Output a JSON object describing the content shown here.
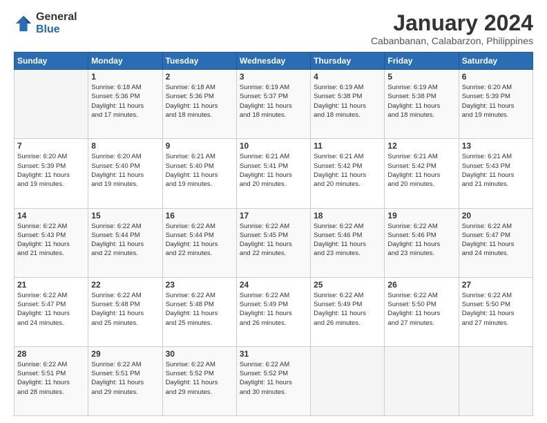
{
  "logo": {
    "general": "General",
    "blue": "Blue"
  },
  "header": {
    "title": "January 2024",
    "subtitle": "Cabanbanan, Calabarzon, Philippines"
  },
  "weekdays": [
    "Sunday",
    "Monday",
    "Tuesday",
    "Wednesday",
    "Thursday",
    "Friday",
    "Saturday"
  ],
  "weeks": [
    [
      {
        "day": "",
        "info": ""
      },
      {
        "day": "1",
        "info": "Sunrise: 6:18 AM\nSunset: 5:36 PM\nDaylight: 11 hours\nand 17 minutes."
      },
      {
        "day": "2",
        "info": "Sunrise: 6:18 AM\nSunset: 5:36 PM\nDaylight: 11 hours\nand 18 minutes."
      },
      {
        "day": "3",
        "info": "Sunrise: 6:19 AM\nSunset: 5:37 PM\nDaylight: 11 hours\nand 18 minutes."
      },
      {
        "day": "4",
        "info": "Sunrise: 6:19 AM\nSunset: 5:38 PM\nDaylight: 11 hours\nand 18 minutes."
      },
      {
        "day": "5",
        "info": "Sunrise: 6:19 AM\nSunset: 5:38 PM\nDaylight: 11 hours\nand 18 minutes."
      },
      {
        "day": "6",
        "info": "Sunrise: 6:20 AM\nSunset: 5:39 PM\nDaylight: 11 hours\nand 19 minutes."
      }
    ],
    [
      {
        "day": "7",
        "info": "Sunrise: 6:20 AM\nSunset: 5:39 PM\nDaylight: 11 hours\nand 19 minutes."
      },
      {
        "day": "8",
        "info": "Sunrise: 6:20 AM\nSunset: 5:40 PM\nDaylight: 11 hours\nand 19 minutes."
      },
      {
        "day": "9",
        "info": "Sunrise: 6:21 AM\nSunset: 5:40 PM\nDaylight: 11 hours\nand 19 minutes."
      },
      {
        "day": "10",
        "info": "Sunrise: 6:21 AM\nSunset: 5:41 PM\nDaylight: 11 hours\nand 20 minutes."
      },
      {
        "day": "11",
        "info": "Sunrise: 6:21 AM\nSunset: 5:42 PM\nDaylight: 11 hours\nand 20 minutes."
      },
      {
        "day": "12",
        "info": "Sunrise: 6:21 AM\nSunset: 5:42 PM\nDaylight: 11 hours\nand 20 minutes."
      },
      {
        "day": "13",
        "info": "Sunrise: 6:21 AM\nSunset: 5:43 PM\nDaylight: 11 hours\nand 21 minutes."
      }
    ],
    [
      {
        "day": "14",
        "info": "Sunrise: 6:22 AM\nSunset: 5:43 PM\nDaylight: 11 hours\nand 21 minutes."
      },
      {
        "day": "15",
        "info": "Sunrise: 6:22 AM\nSunset: 5:44 PM\nDaylight: 11 hours\nand 22 minutes."
      },
      {
        "day": "16",
        "info": "Sunrise: 6:22 AM\nSunset: 5:44 PM\nDaylight: 11 hours\nand 22 minutes."
      },
      {
        "day": "17",
        "info": "Sunrise: 6:22 AM\nSunset: 5:45 PM\nDaylight: 11 hours\nand 22 minutes."
      },
      {
        "day": "18",
        "info": "Sunrise: 6:22 AM\nSunset: 5:46 PM\nDaylight: 11 hours\nand 23 minutes."
      },
      {
        "day": "19",
        "info": "Sunrise: 6:22 AM\nSunset: 5:46 PM\nDaylight: 11 hours\nand 23 minutes."
      },
      {
        "day": "20",
        "info": "Sunrise: 6:22 AM\nSunset: 5:47 PM\nDaylight: 11 hours\nand 24 minutes."
      }
    ],
    [
      {
        "day": "21",
        "info": "Sunrise: 6:22 AM\nSunset: 5:47 PM\nDaylight: 11 hours\nand 24 minutes."
      },
      {
        "day": "22",
        "info": "Sunrise: 6:22 AM\nSunset: 5:48 PM\nDaylight: 11 hours\nand 25 minutes."
      },
      {
        "day": "23",
        "info": "Sunrise: 6:22 AM\nSunset: 5:48 PM\nDaylight: 11 hours\nand 25 minutes."
      },
      {
        "day": "24",
        "info": "Sunrise: 6:22 AM\nSunset: 5:49 PM\nDaylight: 11 hours\nand 26 minutes."
      },
      {
        "day": "25",
        "info": "Sunrise: 6:22 AM\nSunset: 5:49 PM\nDaylight: 11 hours\nand 26 minutes."
      },
      {
        "day": "26",
        "info": "Sunrise: 6:22 AM\nSunset: 5:50 PM\nDaylight: 11 hours\nand 27 minutes."
      },
      {
        "day": "27",
        "info": "Sunrise: 6:22 AM\nSunset: 5:50 PM\nDaylight: 11 hours\nand 27 minutes."
      }
    ],
    [
      {
        "day": "28",
        "info": "Sunrise: 6:22 AM\nSunset: 5:51 PM\nDaylight: 11 hours\nand 28 minutes."
      },
      {
        "day": "29",
        "info": "Sunrise: 6:22 AM\nSunset: 5:51 PM\nDaylight: 11 hours\nand 29 minutes."
      },
      {
        "day": "30",
        "info": "Sunrise: 6:22 AM\nSunset: 5:52 PM\nDaylight: 11 hours\nand 29 minutes."
      },
      {
        "day": "31",
        "info": "Sunrise: 6:22 AM\nSunset: 5:52 PM\nDaylight: 11 hours\nand 30 minutes."
      },
      {
        "day": "",
        "info": ""
      },
      {
        "day": "",
        "info": ""
      },
      {
        "day": "",
        "info": ""
      }
    ]
  ]
}
